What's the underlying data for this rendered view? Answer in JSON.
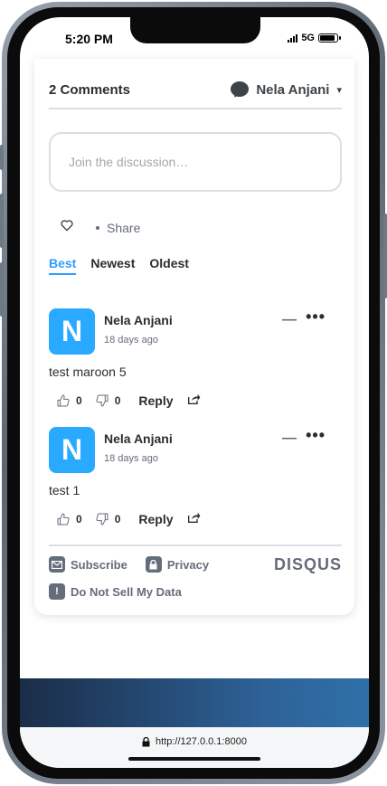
{
  "status_bar": {
    "time": "5:20 PM",
    "network": "5G",
    "battery_level": 0.9
  },
  "header": {
    "comment_count": "2 Comments",
    "user_name": "Nela Anjani",
    "caret": "▾"
  },
  "discussion": {
    "placeholder": "Join the discussion…"
  },
  "actions": {
    "share_label": "Share"
  },
  "tabs": [
    {
      "label": "Best",
      "active": true
    },
    {
      "label": "Newest",
      "active": false
    },
    {
      "label": "Oldest",
      "active": false
    }
  ],
  "comments": [
    {
      "avatar_letter": "N",
      "author": "Nela Anjani",
      "time": "18 days ago",
      "text": "test maroon 5",
      "upvotes": "0",
      "downvotes": "0",
      "reply_label": "Reply",
      "collapse": "—",
      "more": "•••"
    },
    {
      "avatar_letter": "N",
      "author": "Nela Anjani",
      "time": "18 days ago",
      "text": "test 1",
      "upvotes": "0",
      "downvotes": "0",
      "reply_label": "Reply",
      "collapse": "—",
      "more": "•••"
    }
  ],
  "footer": {
    "subscribe": "Subscribe",
    "privacy": "Privacy",
    "do_not_sell": "Do Not Sell My Data",
    "brand": "DISQUS"
  },
  "browser": {
    "url": "http://127.0.0.1:8000"
  },
  "colors": {
    "accent": "#2e9fff",
    "avatar": "#29a9ff",
    "text": "#2a2e2e",
    "muted": "#656c7a"
  }
}
